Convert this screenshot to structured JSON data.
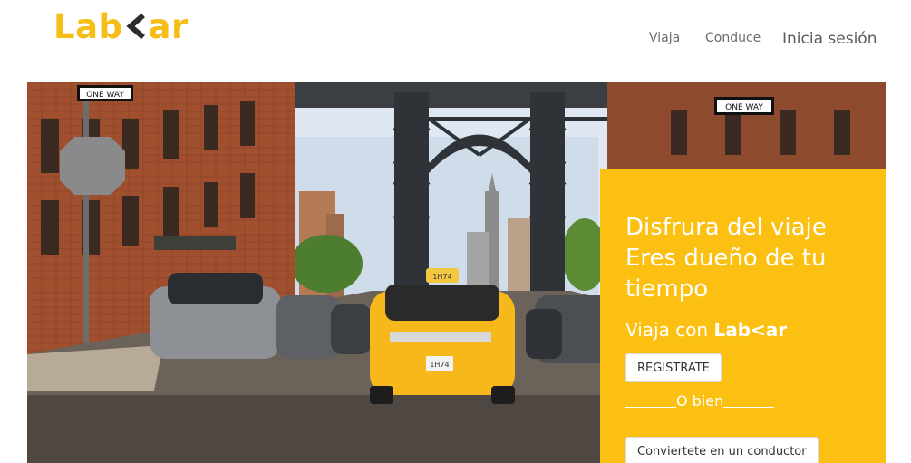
{
  "header": {
    "logo_prefix": "Lab",
    "logo_suffix": "ar",
    "logo_color": "#f6bd16",
    "nav": {
      "viaja": "Viaja",
      "conduce": "Conduce",
      "login": "Inicia sesión"
    }
  },
  "hero": {
    "image": "new-york-street-yellow-taxi-under-manhattan-bridge",
    "signs": [
      "ONE WAY",
      "ONE WAY"
    ],
    "taxi_roof": "1H74",
    "taxi_plate": "1H74"
  },
  "cta": {
    "background": "#fbc011",
    "headline": [
      "Disfrura del viaje",
      "Eres dueño de tu",
      "tiempo"
    ],
    "sub_prefix": "Viaja con ",
    "sub_brand": "Lab<ar",
    "register_label": "REGISTRATE",
    "or_text": "O bien",
    "driver_label": "Conviertete en un conductor"
  }
}
